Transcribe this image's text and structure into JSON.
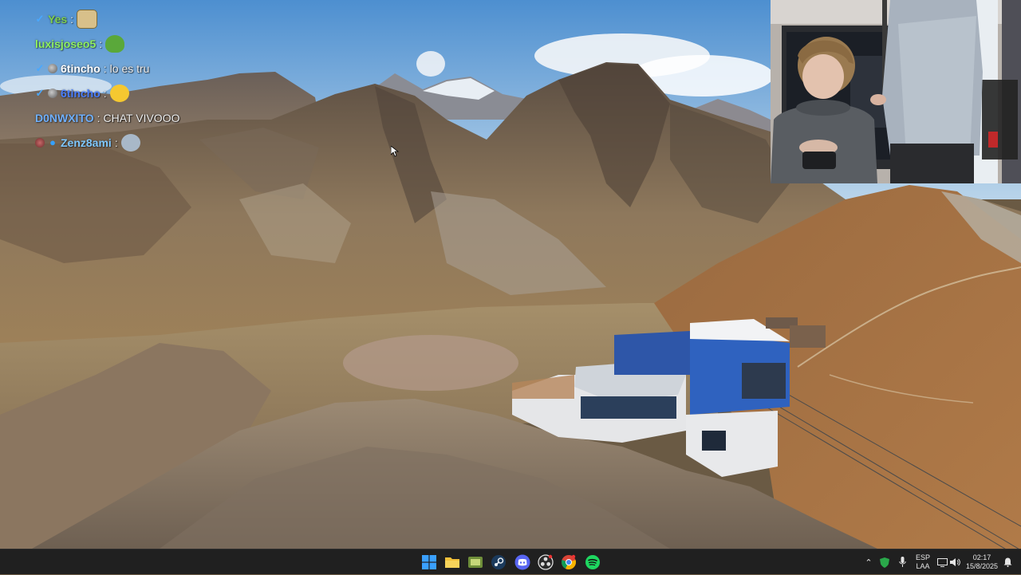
{
  "chat": {
    "messages": [
      {
        "user": "Yes",
        "user_color": "#7fd04f",
        "text": "",
        "badge": "check",
        "emote": "hamster-emote",
        "emote_color": "#d8c08a"
      },
      {
        "user": "luxisjoseo5",
        "user_color": "#8ff05f",
        "text": "",
        "badge": "none",
        "emote": "pepe-emote",
        "emote_color": "#5aa83a"
      },
      {
        "user": "6tincho",
        "user_color": "#ffffff",
        "text": "lo es tru",
        "badge": "check-dot",
        "emote": "",
        "emote_color": ""
      },
      {
        "user": "6tincho",
        "user_color": "#4a7fff",
        "text": "",
        "badge": "check-dot",
        "emote": "laugh-emote",
        "emote_color": "#f5c830"
      },
      {
        "user": "D0NWXITO",
        "user_color": "#6fb0ff",
        "text": "CHAT VIVOOO",
        "badge": "none",
        "emote": "",
        "emote_color": ""
      },
      {
        "user": "Zenz8ami",
        "user_color": "#7fc8ff",
        "text": "",
        "badge": "avatar",
        "emote": "face-emote",
        "emote_color": "#a8b8c8"
      }
    ]
  },
  "taskbar": {
    "apps": [
      {
        "name": "windows-start-icon"
      },
      {
        "name": "file-explorer-icon"
      },
      {
        "name": "game-app-icon"
      },
      {
        "name": "steam-icon"
      },
      {
        "name": "discord-icon"
      },
      {
        "name": "obs-icon"
      },
      {
        "name": "chrome-icon"
      },
      {
        "name": "spotify-icon"
      }
    ],
    "lang_top": "ESP",
    "lang_bottom": "LAA",
    "time": "02:17",
    "date": "15/8/2025"
  }
}
